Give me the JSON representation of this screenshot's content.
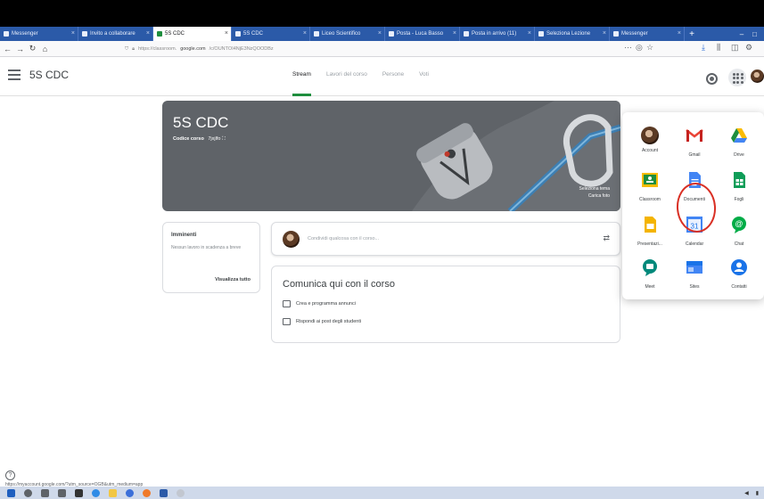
{
  "browser": {
    "tabs": [
      {
        "label": "Messenger",
        "active": false
      },
      {
        "label": "Invito a collaborare",
        "active": false
      },
      {
        "label": "5S CDC",
        "active": true
      },
      {
        "label": "5S CDC",
        "active": false
      },
      {
        "label": "Liceo Scientifico",
        "active": false
      },
      {
        "label": "Posta - Luca Basso",
        "active": false
      },
      {
        "label": "Posta in arrivo (11)",
        "active": false
      },
      {
        "label": "Seleziona Lezione",
        "active": false
      },
      {
        "label": "Messenger",
        "active": false
      }
    ],
    "url_prefix": "https://classroom.",
    "url_domain": "google.com",
    "url_path": "/c/OUNTOI4NjE3NzQOODBz",
    "window_controls": [
      "–",
      "□"
    ]
  },
  "app": {
    "class_title": "5S CDC",
    "tabs": [
      {
        "label": "Stream",
        "active": true
      },
      {
        "label": "Lavori del corso",
        "active": false
      },
      {
        "label": "Persone",
        "active": false
      },
      {
        "label": "Voti",
        "active": false
      }
    ]
  },
  "banner": {
    "title": "5S CDC",
    "code_label": "Codice corso",
    "code_value": "7jxjlfo",
    "select_theme": "Seleziona tema",
    "upload_photo": "Carica foto"
  },
  "upcoming": {
    "heading": "Imminenti",
    "text": "Nessun lavoro in scadenza a breve",
    "link": "Visualizza tutto"
  },
  "share": {
    "placeholder": "Condividi qualcosa con il corso..."
  },
  "communicate": {
    "title": "Comunica qui con il corso",
    "item1": "Crea e programma annunci",
    "item2": "Rispondi ai post degli studenti"
  },
  "apps_menu": {
    "items": [
      {
        "label": "Account",
        "icon": "account-avatar-icon"
      },
      {
        "label": "Gmail",
        "icon": "gmail-icon"
      },
      {
        "label": "Drive",
        "icon": "drive-icon"
      },
      {
        "label": "Classroom",
        "icon": "classroom-icon"
      },
      {
        "label": "Documenti",
        "icon": "docs-icon"
      },
      {
        "label": "Fogli",
        "icon": "sheets-icon"
      },
      {
        "label": "Presentazi...",
        "icon": "slides-icon"
      },
      {
        "label": "Calendar",
        "icon": "calendar-icon"
      },
      {
        "label": "Chat",
        "icon": "chat-icon"
      },
      {
        "label": "Meet",
        "icon": "meet-icon"
      },
      {
        "label": "Sites",
        "icon": "sites-icon"
      },
      {
        "label": "Contatti",
        "icon": "contacts-icon"
      }
    ],
    "calendar_day": "31",
    "highlight_color": "#d93025"
  },
  "status_url": "https://myaccount.google.com/?utm_source=OGB&utm_medium=app",
  "colors": {
    "accent": "#1e8e3e",
    "banner_bg": "#5f6368",
    "tabstrip_bg": "#2b5aa8"
  }
}
